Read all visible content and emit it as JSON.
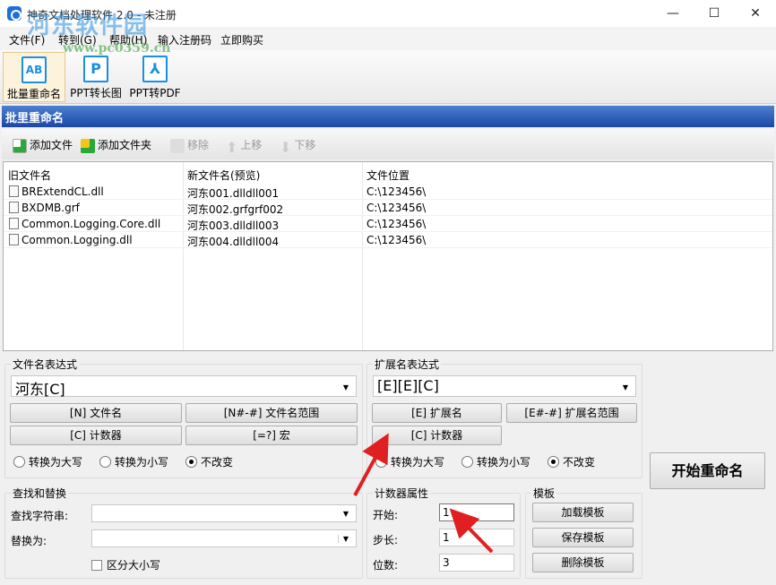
{
  "window": {
    "title": "神奇文档处理软件 2.0 - 未注册",
    "minimize": "—",
    "maximize": "☐",
    "close": "✕"
  },
  "watermark": {
    "name": "河东软件园",
    "url": "www.pc0359.cn"
  },
  "menu": [
    "文件(F)",
    "转到(G)",
    "帮助(H)",
    "输入注册码",
    "立即购买"
  ],
  "toolbar": [
    {
      "label": "批量重命名",
      "icon": "rename-icon",
      "glyph": "AB"
    },
    {
      "label": "PPT转长图",
      "icon": "ppt-icon",
      "glyph": "P"
    },
    {
      "label": "PPT转PDF",
      "icon": "pdf-icon",
      "glyph": "⅄"
    }
  ],
  "panel_title": "批里重命名",
  "actions": {
    "add_file": "添加文件",
    "add_folder": "添加文件夹",
    "remove": "移除",
    "up": "上移",
    "down": "下移"
  },
  "list": {
    "columns": [
      "旧文件名",
      "新文件名(预览)",
      "文件位置"
    ],
    "rows": [
      [
        "BRExtendCL.dll",
        "河东001.dlldll001",
        "C:\\123456\\"
      ],
      [
        "BXDMB.grf",
        "河东002.grfgrf002",
        "C:\\123456\\"
      ],
      [
        "Common.Logging.Core.dll",
        "河东003.dlldll003",
        "C:\\123456\\"
      ],
      [
        "Common.Logging.dll",
        "河东004.dlldll004",
        "C:\\123456\\"
      ]
    ]
  },
  "filename_expr": {
    "legend": "文件名表达式",
    "value": "河东[C]",
    "btn_name": "[N] 文件名",
    "btn_range": "[N#-#] 文件名范围",
    "btn_counter": "[C] 计数器",
    "btn_macro": "[=?] 宏",
    "upper": "转换为大写",
    "lower": "转换为小写",
    "keep": "不改变",
    "selected": "keep"
  },
  "ext_expr": {
    "legend": "扩展名表达式",
    "value": "[E][E][C]",
    "btn_ext": "[E] 扩展名",
    "btn_range": "[E#-#] 扩展名范围",
    "btn_counter": "[C] 计数器",
    "upper": "转换为大写",
    "lower": "转换为小写",
    "keep": "不改变",
    "selected": "keep"
  },
  "find_replace": {
    "legend": "查找和替换",
    "find_label": "查找字符串:",
    "find_value": "",
    "replace_label": "替换为:",
    "replace_value": "",
    "case_label": "区分大小写",
    "case_checked": false
  },
  "counter": {
    "legend": "计数器属性",
    "start_label": "开始:",
    "start": "1",
    "step_label": "步长:",
    "step": "1",
    "digits_label": "位数:",
    "digits": "3"
  },
  "template": {
    "legend": "模板",
    "load": "加载模板",
    "save": "保存模板",
    "delete": "删除模板"
  },
  "start_button": "开始重命名",
  "colors": {
    "header_blue": "#1a47a5",
    "accent": "#1a8fe3",
    "arrow": "#e02020"
  }
}
